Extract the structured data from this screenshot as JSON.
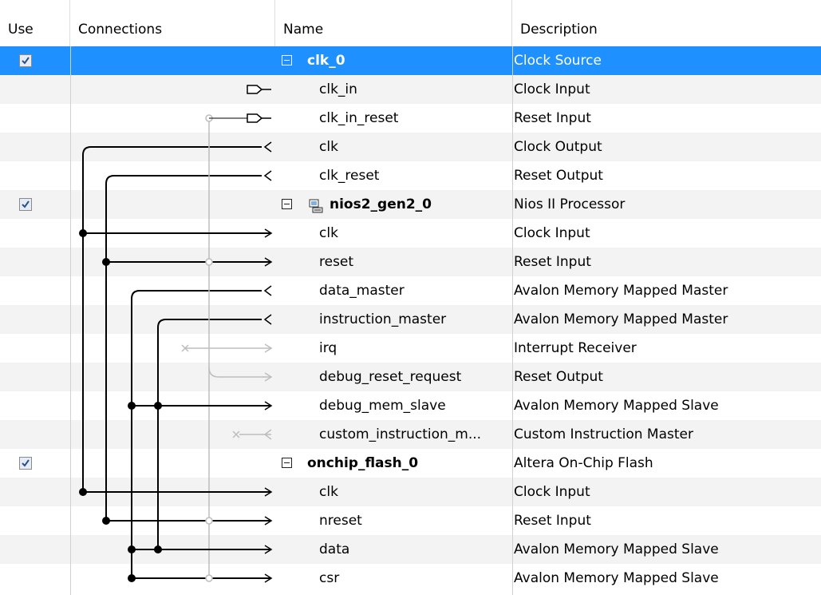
{
  "columns": {
    "use": "Use",
    "connections": "Connections",
    "name": "Name",
    "description": "Description"
  },
  "rows": [
    {
      "kind": "component",
      "name": "clk_0",
      "description": "Clock Source",
      "checked": true,
      "selected": true,
      "icon": "none"
    },
    {
      "kind": "port",
      "name": "clk_in",
      "description": "Clock Input"
    },
    {
      "kind": "port",
      "name": "clk_in_reset",
      "description": "Reset Input"
    },
    {
      "kind": "port",
      "name": "clk",
      "description": "Clock Output"
    },
    {
      "kind": "port",
      "name": "clk_reset",
      "description": "Reset Output"
    },
    {
      "kind": "component",
      "name": "nios2_gen2_0",
      "description": "Nios II Processor",
      "checked": true,
      "icon": "cpu-icon"
    },
    {
      "kind": "port",
      "name": "clk",
      "description": "Clock Input"
    },
    {
      "kind": "port",
      "name": "reset",
      "description": "Reset Input"
    },
    {
      "kind": "port",
      "name": "data_master",
      "description": "Avalon Memory Mapped Master"
    },
    {
      "kind": "port",
      "name": "instruction_master",
      "description": "Avalon Memory Mapped Master"
    },
    {
      "kind": "port",
      "name": "irq",
      "description": "Interrupt Receiver"
    },
    {
      "kind": "port",
      "name": "debug_reset_request",
      "description": "Reset Output"
    },
    {
      "kind": "port",
      "name": "debug_mem_slave",
      "description": "Avalon Memory Mapped Slave"
    },
    {
      "kind": "port",
      "name": "custom_instruction_m...",
      "description": "Custom Instruction Master"
    },
    {
      "kind": "component",
      "name": "onchip_flash_0",
      "description": "Altera On-Chip Flash",
      "checked": true,
      "icon": "none"
    },
    {
      "kind": "port",
      "name": "clk",
      "description": "Clock Input"
    },
    {
      "kind": "port",
      "name": "nreset",
      "description": "Reset Input"
    },
    {
      "kind": "port",
      "name": "data",
      "description": "Avalon Memory Mapped Slave"
    },
    {
      "kind": "port",
      "name": "csr",
      "description": "Avalon Memory Mapped Slave"
    }
  ],
  "colors": {
    "selection": "#1e90ff",
    "alt_row": "#f3f3f3",
    "wire": "#000000",
    "inactive_wire": "#bdbdbd"
  }
}
